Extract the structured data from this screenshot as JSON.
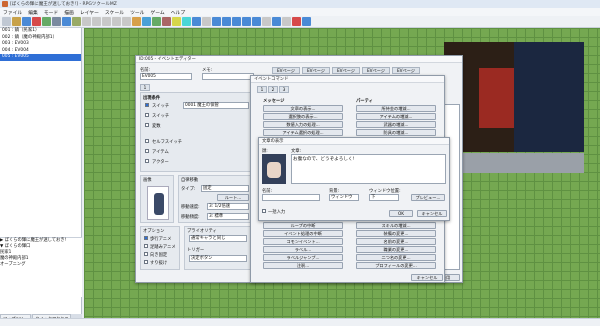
{
  "app": {
    "title": "[ぼくらの輝に魔王が迷しておき!] - RPGツクールMZ"
  },
  "menubar": [
    "ファイル",
    "編集",
    "モード",
    "描画",
    "レイヤー",
    "スケール",
    "ツール",
    "ゲーム",
    "ヘルプ"
  ],
  "maps": [
    {
      "label": "001 : 鎮（民家1）"
    },
    {
      "label": "002 : 鎮（魔の神殿内部1）"
    },
    {
      "label": "003 : EV003"
    },
    {
      "label": "004 : EV004"
    },
    {
      "label": "005 : EV005",
      "selected": true
    }
  ],
  "tree": [
    "▶ ぼくらの輝に魔王が迷しておき!",
    "▼ ぼくらの輝口",
    "   民家1",
    "   魔の神殿内部1",
    "   オープニング"
  ],
  "bottom_tabs": [
    "マップツリー",
    "クイックアクセス"
  ],
  "event_editor": {
    "title": "ID:005 - イベントエディター",
    "name_label": "名前:",
    "name_value": "EV005",
    "note_label": "メモ:",
    "page_tabs": [
      "EVページ",
      "EVページ",
      "EVページ",
      "EVページ",
      "EVページ"
    ],
    "page_num": "1",
    "conditions_label": "出現条件",
    "switch_label": "スイッチ",
    "switch_value": "0001 魔王の保管",
    "switch2_label": "スイッチ",
    "var_label": "変数",
    "selfswitch_label": "セルフスイッチ",
    "item_label": "アイテム",
    "actor_label": "アクター",
    "image_label": "画像",
    "autonomous_label": "自律移動",
    "type_label": "タイプ:",
    "type_value": "固定",
    "route_btn": "ルート...",
    "speed_label": "移動速度:",
    "speed_value": "3: 1/2倍速",
    "freq_label": "移動頻度:",
    "freq_value": "3: 標準",
    "options_label": "オプション",
    "opt1": "歩行アニメ",
    "opt2": "足踏みアニメ",
    "opt3": "向き固定",
    "opt4": "すり抜け",
    "priority_label": "プライオリティ",
    "priority_value": "通常キャラと同じ",
    "trigger_label": "トリガー",
    "trigger_value": "決定ボタン",
    "contents_label": "実行内容",
    "cancel": "キャンセル",
    "apply": "適用"
  },
  "command_dialog": {
    "title": "イベントコマンド",
    "tabs": [
      "1",
      "2",
      "3"
    ],
    "message_label": "メッセージ",
    "party_label": "パーティ",
    "left": [
      "文章の表示...",
      "選択肢の表示...",
      "数値入力の処理...",
      "アイテム選択の処理..."
    ],
    "right": [
      "所持金の増減...",
      "アイテムの増減...",
      "武器の増減...",
      "防具の増減..."
    ],
    "left2": [
      "ループの中断",
      "イベント処理の中断",
      "コモンイベント...",
      "ラベル...",
      "ラベルジャンプ...",
      "注釈..."
    ],
    "right2": [
      "スキルの増減...",
      "装備の変更...",
      "名前の変更...",
      "職業の変更...",
      "二つ名の変更...",
      "プロフィールの変更..."
    ],
    "cancel": "キャンセル"
  },
  "text_dialog": {
    "title": "文章の表示",
    "face_label": "顔:",
    "text_label": "文章:",
    "text_value": "お腹なので、どうぞよろしく!",
    "name_label": "名前:",
    "bg_label": "背景:",
    "bg_value": "ウィンドウ",
    "pos_label": "ウィンドウ位置:",
    "pos_value": "下",
    "preview": "プレビュー...",
    "batch_label": "一括入力",
    "ok": "OK",
    "cancel": "キャンセル"
  }
}
